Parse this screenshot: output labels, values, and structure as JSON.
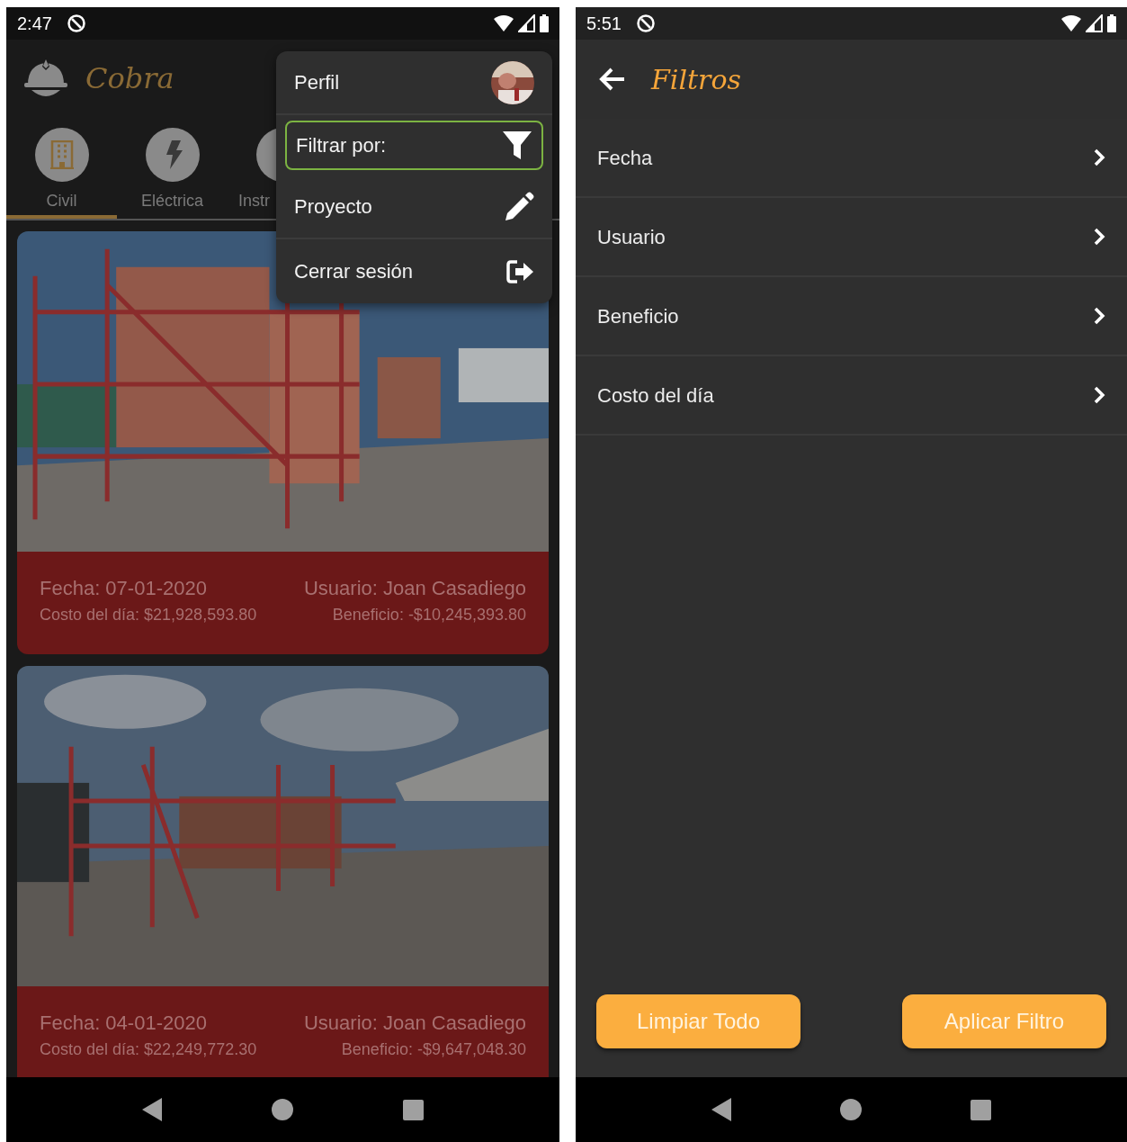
{
  "main_screen": {
    "status_bar": {
      "time": "2:47"
    },
    "app_bar": {
      "title": "Cobra"
    },
    "categories": [
      {
        "label": "Civil",
        "kind": "building",
        "selected": true
      },
      {
        "label": "Eléctrica",
        "kind": "bolt",
        "selected": false
      },
      {
        "label": "Instr",
        "kind": "other",
        "selected": false
      }
    ],
    "records": [
      {
        "fecha": "Fecha: 07-01-2020",
        "costo": "Costo del día: $21,928,593.80",
        "usuario": "Usuario: Joan Casadiego",
        "beneficio": "Beneficio: -$10,245,393.80"
      },
      {
        "fecha": "Fecha: 04-01-2020",
        "costo": "Costo del día: $22,249,772.30",
        "usuario": "Usuario: Joan Casadiego",
        "beneficio": "Beneficio: -$9,647,048.30"
      }
    ],
    "menu": [
      {
        "label": "Perfil",
        "kind": "avatar",
        "selected": false
      },
      {
        "label": "Filtrar por:",
        "kind": "filter",
        "selected": true
      },
      {
        "label": "Proyecto",
        "kind": "edit",
        "selected": false
      },
      {
        "label": "Cerrar sesión",
        "kind": "logout",
        "selected": false
      }
    ]
  },
  "filters_screen": {
    "status_bar": {
      "time": "5:51"
    },
    "app_bar": {
      "title": "Filtros"
    },
    "options": [
      {
        "label": "Fecha"
      },
      {
        "label": "Usuario"
      },
      {
        "label": "Beneficio"
      },
      {
        "label": "Costo del día"
      }
    ],
    "buttons": [
      {
        "label": "Limpiar Todo"
      },
      {
        "label": "Aplicar Filtro"
      }
    ]
  }
}
